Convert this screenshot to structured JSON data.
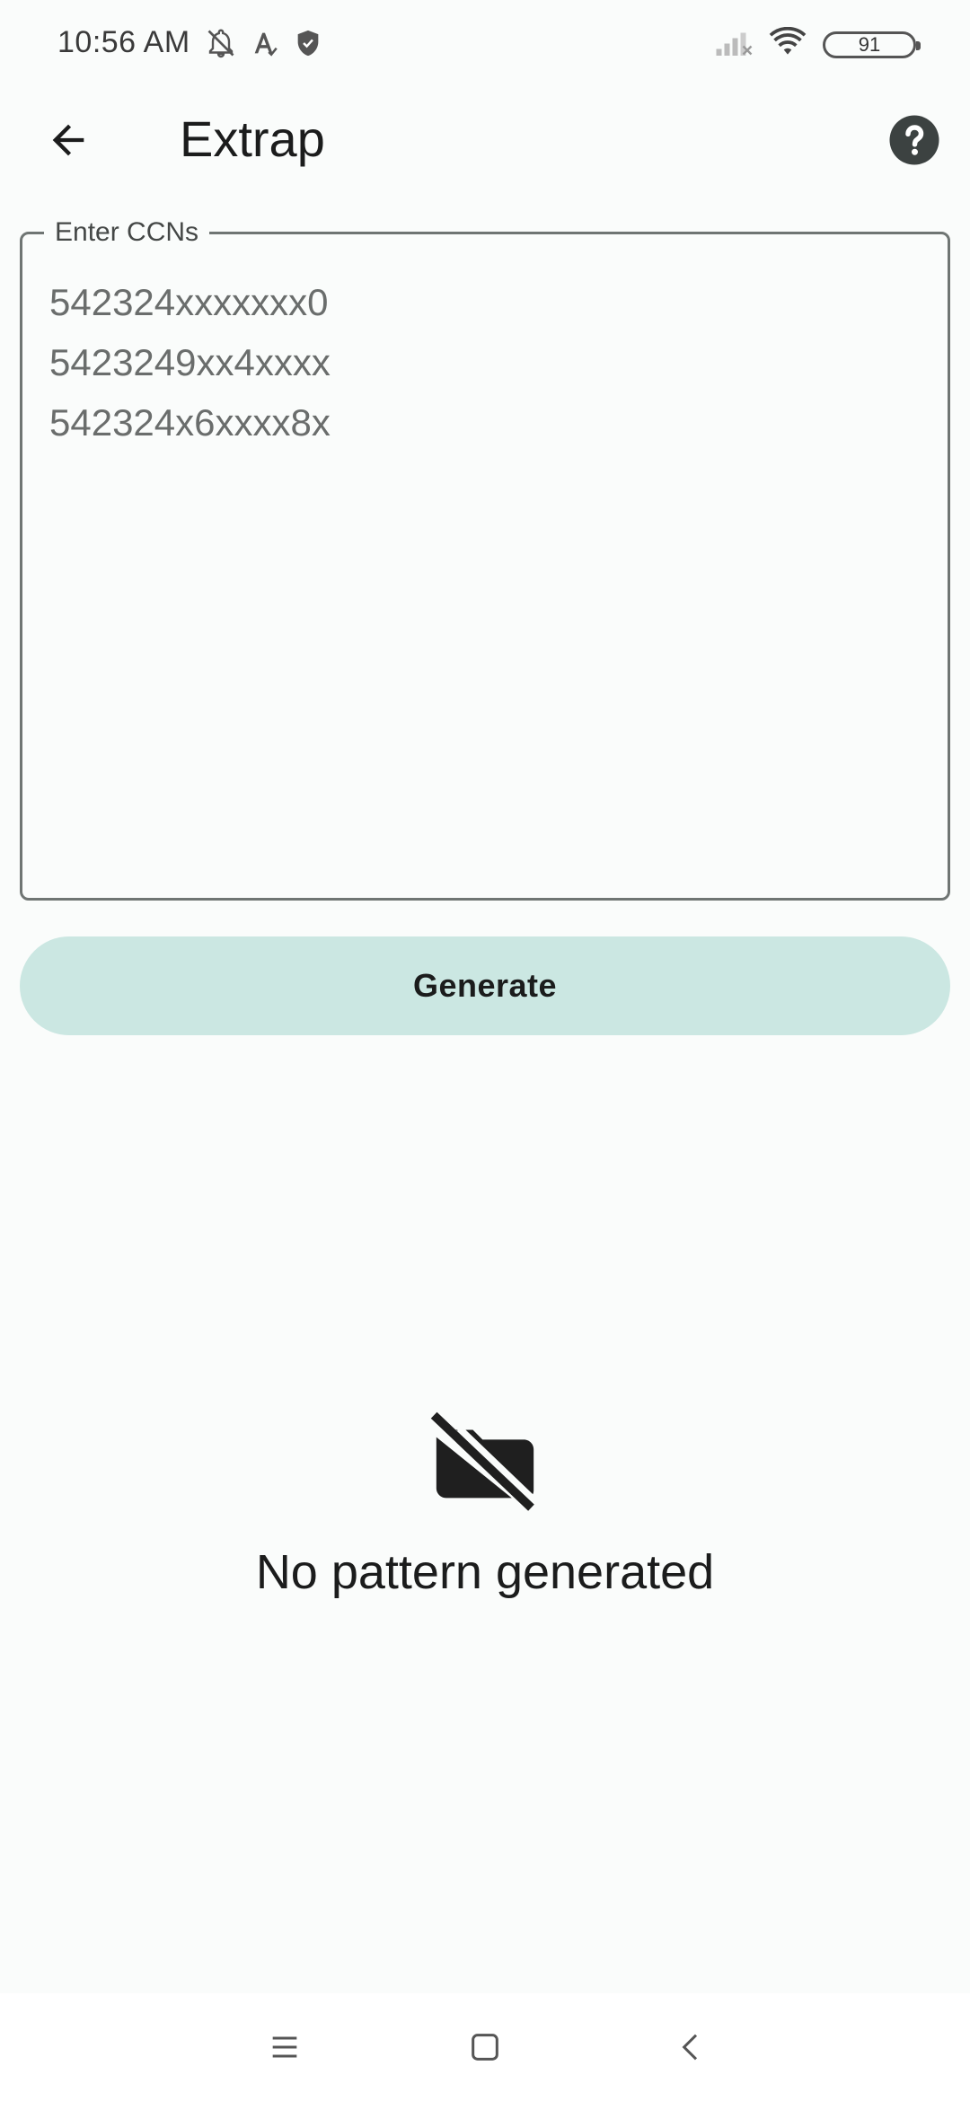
{
  "status_bar": {
    "time": "10:56 AM",
    "battery": "91",
    "icons": [
      "muted-bell-icon",
      "autofill-icon",
      "shield-icon",
      "signal-icon",
      "wifi-icon",
      "battery-icon"
    ]
  },
  "app_bar": {
    "title": "Extrap",
    "back_icon": "arrow-back-icon",
    "help_icon": "help-circle-icon"
  },
  "ccn_input": {
    "label": "Enter CCNs",
    "value": "542324xxxxxxx0\n5423249xx4xxxx\n542324x6xxxx8x"
  },
  "generate_button": {
    "label": "Generate"
  },
  "empty_state": {
    "icon": "folder-off-icon",
    "message": "No pattern generated"
  },
  "nav_bar": {
    "icons": [
      "menu-icon",
      "home-square-icon",
      "back-chevron-icon"
    ]
  },
  "colors": {
    "background": "#fafcfb",
    "button": "#cbe7e2",
    "outline": "#6f7573",
    "text": "#1b1c1c"
  }
}
